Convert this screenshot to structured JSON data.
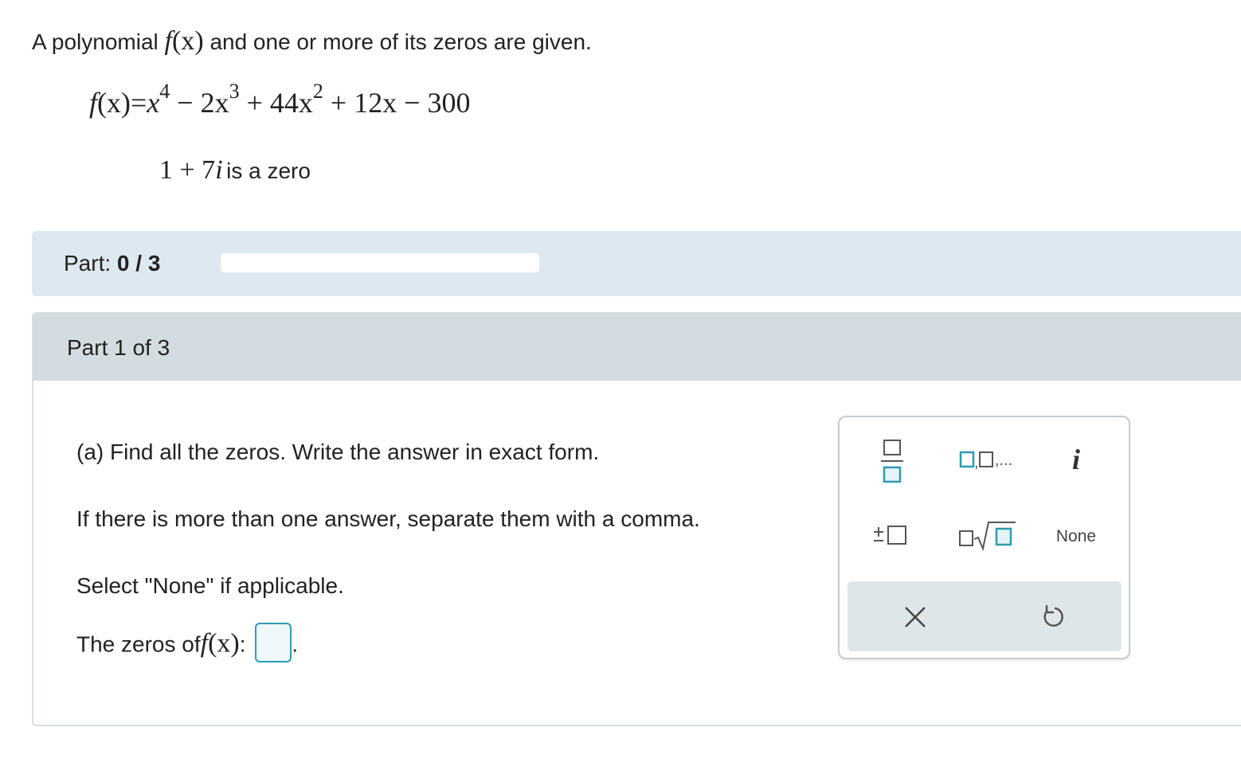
{
  "problem": {
    "intro_before": "A polynomial",
    "intro_func": "f",
    "intro_arg": "(x)",
    "intro_after": "and one or more of its zeros are given.",
    "poly_f": "f",
    "poly_arg": "(x)",
    "poly_eq": "=",
    "poly_x1": "x",
    "poly_e1": "4",
    "poly_t2": "− 2x",
    "poly_e2": "3",
    "poly_t3": "+ 44x",
    "poly_e3": "2",
    "poly_t4": "+ 12x − 300",
    "zero_num": "1 + 7",
    "zero_i": "i",
    "zero_text": "is a zero"
  },
  "progress": {
    "label": "Part:",
    "value": "0 / 3",
    "fraction": 0
  },
  "part": {
    "title": "Part 1 of 3",
    "instruction_a": "(a) Find all the zeros. Write the answer in exact form.",
    "instruction_b": "If there is more than one answer, separate them with a comma.",
    "instruction_c": "Select \"None\" if applicable.",
    "answer_prefix": "The zeros of",
    "answer_func": "f",
    "answer_arg": "(x)",
    "answer_colon": ":",
    "answer_period": "."
  },
  "palette": {
    "fraction_icon": "fraction-icon",
    "list_icon": "list-icon",
    "list_suffix": ",...",
    "imaginary_label": "i",
    "plus_minus_icon": "plus-minus-icon",
    "nth_root_icon": "nth-root-icon",
    "none_label": "None",
    "clear_icon": "x-icon",
    "undo_icon": "undo-icon"
  },
  "colors": {
    "accent": "#2e9bb3",
    "progress_bg": "#dde8f0",
    "header_bg": "#d3dce1",
    "action_bg": "#dfe6ea"
  }
}
